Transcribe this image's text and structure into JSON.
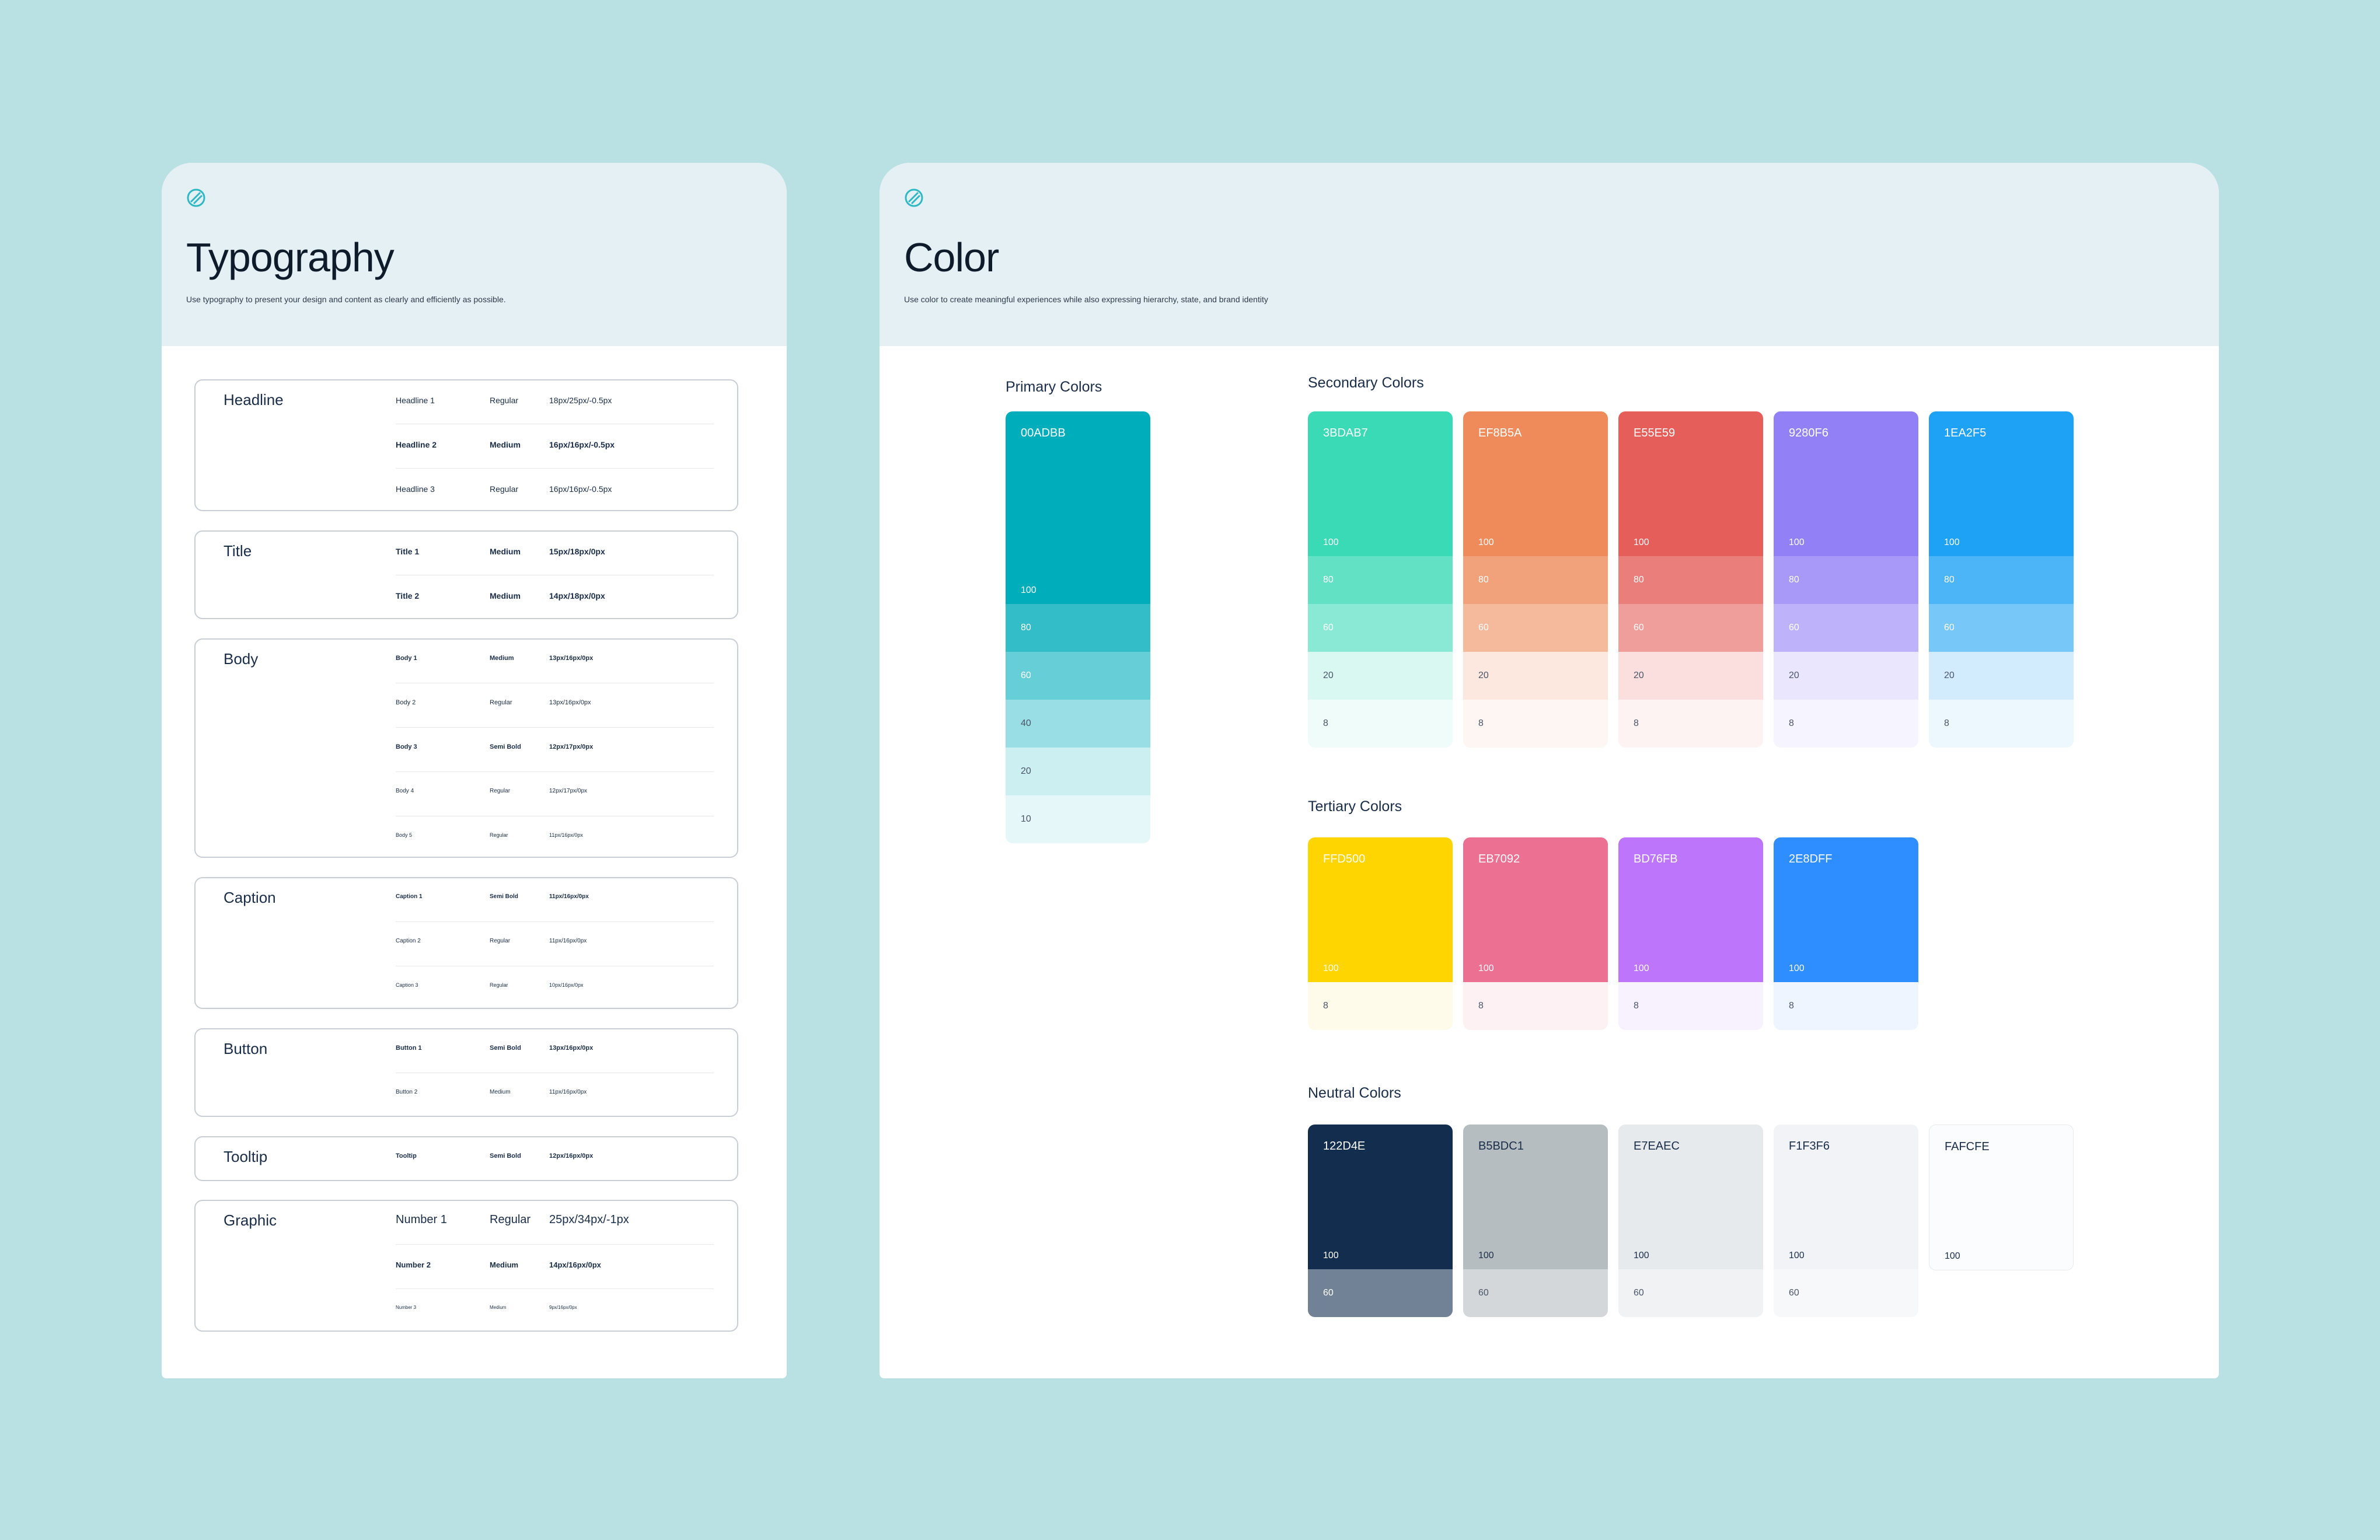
{
  "typography": {
    "title": "Typography",
    "subtitle": "Use typography to present your design and content as clearly and efficiently as possible.",
    "groups": [
      {
        "name": "Headline",
        "rows": [
          {
            "name": "Headline 1",
            "weight": "Regular",
            "spec": "18px/25px/-0.5px"
          },
          {
            "name": "Headline 2",
            "weight": "Medium",
            "spec": "16px/16px/-0.5px"
          },
          {
            "name": "Headline 3",
            "weight": "Regular",
            "spec": "16px/16px/-0.5px"
          }
        ]
      },
      {
        "name": "Title",
        "rows": [
          {
            "name": "Title 1",
            "weight": "Medium",
            "spec": "15px/18px/0px"
          },
          {
            "name": "Title 2",
            "weight": "Medium",
            "spec": "14px/18px/0px"
          }
        ]
      },
      {
        "name": "Body",
        "rows": [
          {
            "name": "Body 1",
            "weight": "Medium",
            "spec": "13px/16px/0px"
          },
          {
            "name": "Body 2",
            "weight": "Regular",
            "spec": "13px/16px/0px"
          },
          {
            "name": "Body 3",
            "weight": "Semi Bold",
            "spec": "12px/17px/0px"
          },
          {
            "name": "Body 4",
            "weight": "Regular",
            "spec": "12px/17px/0px"
          },
          {
            "name": "Body 5",
            "weight": "Regular",
            "spec": "11px/16px/0px"
          }
        ]
      },
      {
        "name": "Caption",
        "rows": [
          {
            "name": "Caption 1",
            "weight": "Semi Bold",
            "spec": "11px/16px/0px"
          },
          {
            "name": "Caption 2",
            "weight": "Regular",
            "spec": "11px/16px/0px"
          },
          {
            "name": "Caption 3",
            "weight": "Regular",
            "spec": "10px/16px/0px"
          }
        ]
      },
      {
        "name": "Button",
        "rows": [
          {
            "name": "Button 1",
            "weight": "Semi Bold",
            "spec": "13px/16px/0px"
          },
          {
            "name": "Button 2",
            "weight": "Medium",
            "spec": "11px/16px/0px"
          }
        ]
      },
      {
        "name": "Tooltip",
        "rows": [
          {
            "name": "Tooltip",
            "weight": "Semi Bold",
            "spec": "12px/16px/0px"
          }
        ]
      },
      {
        "name": "Graphic",
        "rows": [
          {
            "name": "Number 1",
            "weight": "Regular",
            "spec": "25px/34px/-1px"
          },
          {
            "name": "Number 2",
            "weight": "Medium",
            "spec": "14px/16px/0px"
          },
          {
            "name": "Number 3",
            "weight": "Medium",
            "spec": "9px/16px/0px"
          }
        ]
      }
    ]
  },
  "color": {
    "title": "Color",
    "subtitle": "Use color to create meaningful experiences while also expressing hierarchy, state, and brand identity",
    "primary_label": "Primary Colors",
    "secondary_label": "Secondary Colors",
    "tertiary_label": "Tertiary Colors",
    "neutral_label": "Neutral Colors",
    "primary": {
      "hex": "00ADBB",
      "color": "#00ADBB",
      "main_level": "100",
      "tints": [
        {
          "level": "80",
          "color": "#33BDC9"
        },
        {
          "level": "60",
          "color": "#66CED6"
        },
        {
          "level": "40",
          "color": "#99DEE4"
        },
        {
          "level": "20",
          "color": "#CCEFF1"
        },
        {
          "level": "10",
          "color": "#E5F7F8"
        }
      ]
    },
    "secondary": [
      {
        "hex": "3BDAB7",
        "color": "#3BDAB7",
        "main_level": "100",
        "tints": [
          {
            "level": "80",
            "color": "#62E1C5"
          },
          {
            "level": "60",
            "color": "#89E9D4"
          },
          {
            "level": "20",
            "color": "#D8F8F1"
          },
          {
            "level": "8",
            "color": "#F0FCF9"
          }
        ]
      },
      {
        "hex": "EF8B5A",
        "color": "#EF8B5A",
        "main_level": "100",
        "tints": [
          {
            "level": "80",
            "color": "#F2A27B"
          },
          {
            "level": "60",
            "color": "#F5B99C"
          },
          {
            "level": "20",
            "color": "#FCE8DE"
          },
          {
            "level": "8",
            "color": "#FEF6F2"
          }
        ]
      },
      {
        "hex": "E55E59",
        "color": "#E55E59",
        "main_level": "100",
        "tints": [
          {
            "level": "80",
            "color": "#EA7E7A"
          },
          {
            "level": "60",
            "color": "#EF9E9B"
          },
          {
            "level": "20",
            "color": "#FADFDE"
          },
          {
            "level": "8",
            "color": "#FDF3F2"
          }
        ]
      },
      {
        "hex": "9280F6",
        "color": "#9280F6",
        "main_level": "100",
        "tints": [
          {
            "level": "80",
            "color": "#A899F8"
          },
          {
            "level": "60",
            "color": "#BEB3FA"
          },
          {
            "level": "20",
            "color": "#E9E6FD"
          },
          {
            "level": "8",
            "color": "#F6F4FE"
          }
        ]
      },
      {
        "hex": "1EA2F5",
        "color": "#1EA2F5",
        "main_level": "100",
        "tints": [
          {
            "level": "80",
            "color": "#4BB5F7"
          },
          {
            "level": "60",
            "color": "#78C7F9"
          },
          {
            "level": "20",
            "color": "#D2ECFD"
          },
          {
            "level": "8",
            "color": "#EDF7FE"
          }
        ]
      }
    ],
    "tertiary": [
      {
        "hex": "FFD500",
        "color": "#FFD500",
        "main_level": "100",
        "tints": [
          {
            "level": "8",
            "color": "#FFFBEB"
          }
        ]
      },
      {
        "hex": "EB7092",
        "color": "#EB7092",
        "main_level": "100",
        "tints": [
          {
            "level": "8",
            "color": "#FDF1F4"
          }
        ]
      },
      {
        "hex": "BD76FB",
        "color": "#BD76FB",
        "main_level": "100",
        "tints": [
          {
            "level": "8",
            "color": "#F8F2FF"
          }
        ]
      },
      {
        "hex": "2E8DFF",
        "color": "#2E8DFF",
        "main_level": "100",
        "tints": [
          {
            "level": "8",
            "color": "#EEF5FF"
          }
        ]
      }
    ],
    "neutral": [
      {
        "hex": "122D4E",
        "color": "#122D4E",
        "main_level": "100",
        "tints": [
          {
            "level": "60",
            "color": "#718196"
          }
        ]
      },
      {
        "hex": "B5BDC1",
        "color": "#B5BDC1",
        "main_level": "100",
        "tints": [
          {
            "level": "60",
            "color": "#D3D7DA"
          }
        ]
      },
      {
        "hex": "E7EAEC",
        "color": "#E7EAEC",
        "main_level": "100",
        "tints": [
          {
            "level": "60",
            "color": "#F1F2F4"
          }
        ]
      },
      {
        "hex": "F1F3F6",
        "color": "#F1F3F6",
        "main_level": "100",
        "tints": [
          {
            "level": "60",
            "color": "#F7F8FA"
          }
        ]
      },
      {
        "hex": "FAFCFE",
        "color": "#FAFCFE",
        "main_level": "100",
        "tints": []
      }
    ]
  }
}
